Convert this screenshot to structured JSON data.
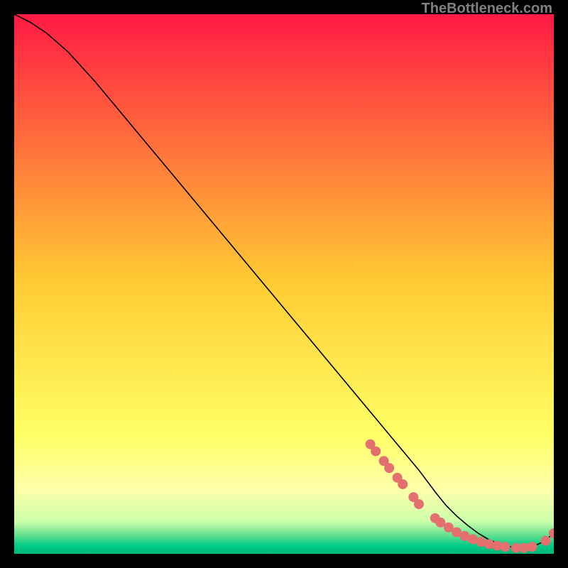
{
  "watermark": "TheBottleneck.com",
  "chart_data": {
    "type": "line",
    "title": "",
    "xlabel": "",
    "ylabel": "",
    "xlim": [
      0,
      100
    ],
    "ylim": [
      0,
      100
    ],
    "background_gradient": {
      "stops": [
        {
          "pos": 0.0,
          "color": "#ff1a44"
        },
        {
          "pos": 0.5,
          "color": "#ffcc33"
        },
        {
          "pos": 0.78,
          "color": "#ffff66"
        },
        {
          "pos": 0.88,
          "color": "#ffffaa"
        },
        {
          "pos": 0.94,
          "color": "#ccffaa"
        },
        {
          "pos": 0.965,
          "color": "#66e090"
        },
        {
          "pos": 0.985,
          "color": "#00cc88"
        },
        {
          "pos": 1.0,
          "color": "#00b878"
        }
      ]
    },
    "curve": {
      "x": [
        0,
        3,
        6,
        10,
        15,
        20,
        25,
        30,
        35,
        40,
        45,
        50,
        55,
        60,
        65,
        70,
        75,
        78,
        80,
        82,
        84,
        86,
        88,
        90,
        92,
        94,
        96,
        98,
        100
      ],
      "y": [
        100,
        98.5,
        96.5,
        93,
        87.5,
        81.5,
        75.5,
        69.5,
        63.5,
        57.5,
        51.5,
        45.5,
        39.5,
        33.5,
        27.5,
        21.5,
        15.5,
        11.5,
        9,
        7,
        5.3,
        3.8,
        2.6,
        1.8,
        1.3,
        1.1,
        1.3,
        2.2,
        3.8
      ]
    },
    "markers": {
      "x": [
        66,
        67,
        68.5,
        69.5,
        71,
        72,
        74,
        75,
        78,
        79,
        80.5,
        82,
        83.5,
        85,
        86.5,
        88,
        89.5,
        91,
        93,
        94.5,
        96,
        98.5,
        100
      ],
      "y": [
        20.3,
        19,
        17.2,
        15.9,
        14.1,
        12.9,
        10.5,
        9.2,
        6.6,
        5.8,
        4.9,
        4.0,
        3.3,
        2.7,
        2.2,
        1.8,
        1.5,
        1.3,
        1.1,
        1.1,
        1.3,
        2.4,
        3.8
      ],
      "color": "#e36f6f",
      "size": 7
    }
  }
}
